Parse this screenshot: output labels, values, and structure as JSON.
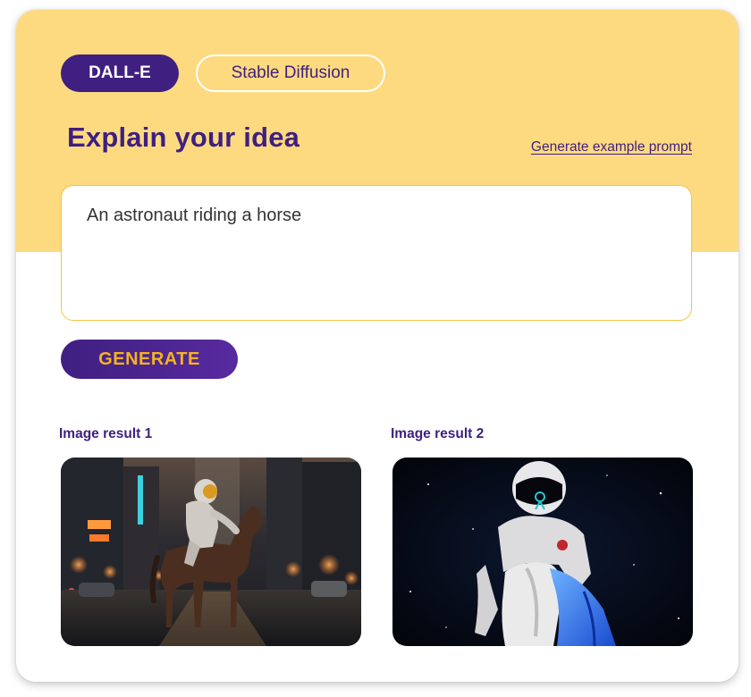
{
  "model_tabs": [
    {
      "label": "DALL-E",
      "selected": true
    },
    {
      "label": "Stable Diffusion",
      "selected": false
    }
  ],
  "heading": "Explain your idea",
  "example_link": "Generate example prompt",
  "prompt": {
    "value": "An astronaut riding a horse"
  },
  "generate_label": "GENERATE",
  "results": [
    {
      "label": "Image result 1",
      "image": "astronaut-on-horse-city-street"
    },
    {
      "label": "Image result 2",
      "image": "astronaut-on-white-horse-space"
    }
  ],
  "colors": {
    "brand_purple": "#3f1f80",
    "header_yellow": "#fdda80",
    "generate_text": "#f5b31f",
    "input_border": "#f2c544"
  }
}
